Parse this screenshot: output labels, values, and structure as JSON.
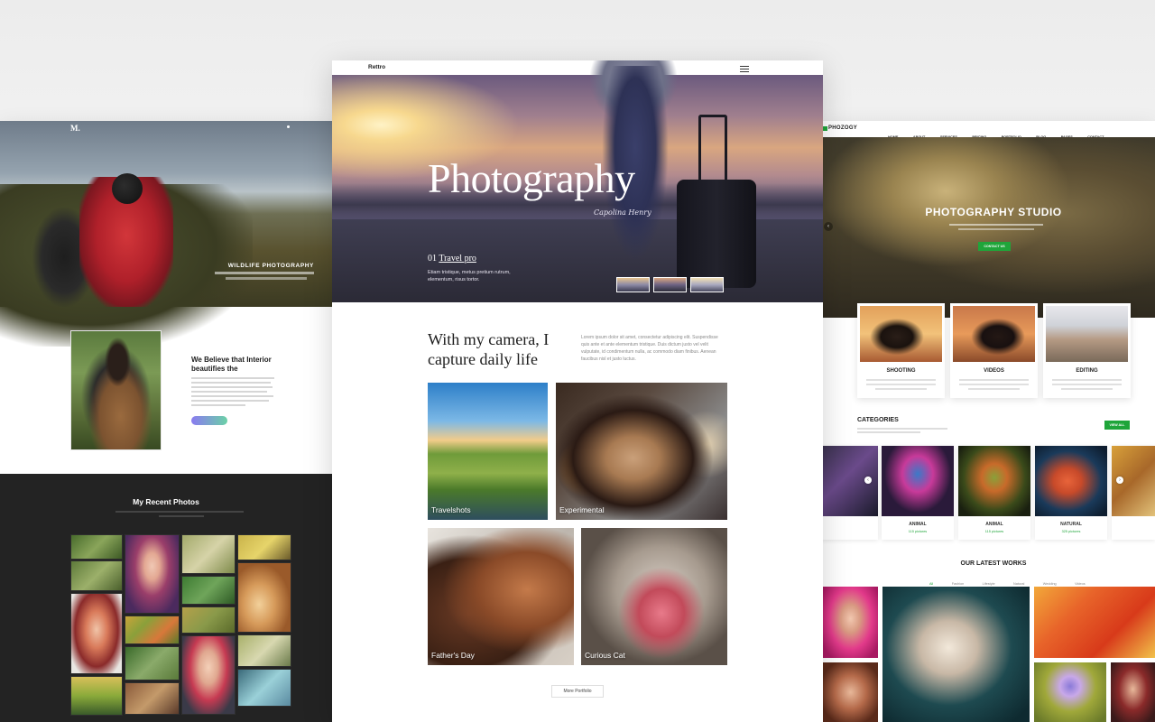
{
  "left_template": {
    "logo": "M.",
    "hero_title": "WILDLIFE PHOTOGRAPHY",
    "about_heading": "We Believe that Interior beautifies the",
    "gallery_title": "My Recent Photos"
  },
  "middle_template": {
    "brand": "Rettro",
    "hero_title": "Photography",
    "hero_signature": "Capolina Henry",
    "slide_number": "01",
    "slide_title": "Travel pro",
    "slide_description": "Etiam tristique, metus pretium rutrum, elementum, risus tortor.",
    "intro_heading": "With my camera, I capture daily life",
    "intro_text": "Lorem ipsum dolor sit amet, consectetur adipiscing elit. Suspendisse quis ante et ante elementum tristique. Duis dictum justo vel velit vulputate, id condimentum nulla, ac commodo diam finibus. Aenean faucibus nisl et justo luctus.",
    "portfolio": [
      {
        "label": "Travelshots"
      },
      {
        "label": "Experimental"
      },
      {
        "label": "Father's Day"
      },
      {
        "label": "Curious Cat"
      }
    ],
    "more_button": "More Portfolio"
  },
  "right_template": {
    "logo": "PHOZOGY",
    "nav": [
      "HOME",
      "ABOUT",
      "SERVICES",
      "PRICING",
      "PORTFOLIO",
      "BLOG",
      "PAGES",
      "CONTACT"
    ],
    "hero_title": "PHOTOGRAPHY STUDIO",
    "hero_button": "CONTACT US",
    "services": [
      {
        "title": "SHOOTING"
      },
      {
        "title": "VIDEOS"
      },
      {
        "title": "EDITING"
      }
    ],
    "categories_heading": "CATEGORIES",
    "view_all": "VIEW ALL",
    "categories": [
      {
        "title": "ANIMAL",
        "count": "115 pictures"
      },
      {
        "title": "ANIMAL",
        "count": "115 pictures"
      },
      {
        "title": "NATURAL",
        "count": "325 pictures"
      }
    ],
    "works_heading": "OUR LATEST WORKS",
    "work_filters": [
      "All",
      "Fashion",
      "Lifestyle",
      "Natural",
      "Wedding",
      "Videos"
    ]
  },
  "colors": {
    "accent_green": "#1fa53a",
    "dark_section": "#232323"
  }
}
